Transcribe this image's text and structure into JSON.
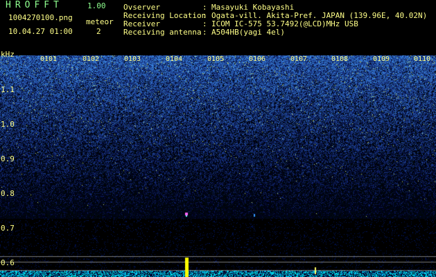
{
  "app": {
    "name": "HROFFT",
    "version": "1.00"
  },
  "file": {
    "name": "1004270100.png",
    "datetime": "10.04.27 01:00"
  },
  "meteor": {
    "label": "meteor",
    "count": "2"
  },
  "station": [
    {
      "label": "Ovserver",
      "value": "Masayuki Kobayashi"
    },
    {
      "label": "Receiving Location",
      "value": "Ogata-vill. Akita-Pref. JAPAN (139.96E, 40.02N)"
    },
    {
      "label": "Receiver",
      "value": "ICOM IC-575 53.7492(@LCD)MHz USB"
    },
    {
      "label": "Receiving antenna",
      "value": "A504HB(yagi 4el)"
    }
  ],
  "axis": {
    "unit": "kHz",
    "y_ticks": [
      "1.1",
      "1.0",
      "0.9",
      "0.8",
      "0.7",
      "0.6"
    ],
    "x_ticks": [
      "0101",
      "0102",
      "0103",
      "0104",
      "0105",
      "0106",
      "0107",
      "0108",
      "0109",
      "0110"
    ]
  },
  "colors": {
    "label": "#ffff88",
    "title": "#8fff8f",
    "noise_low": "#0a1460",
    "noise_high": "#4fa0ff",
    "trace": "#00ffff",
    "meteor": "#ffff00"
  }
}
